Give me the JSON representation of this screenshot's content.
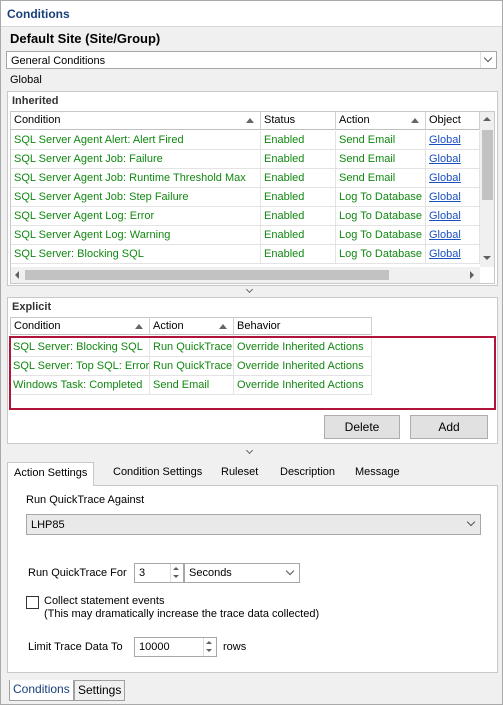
{
  "window": {
    "title": "Conditions"
  },
  "site_title": "Default Site (Site/Group)",
  "condition_type_combo": {
    "value": "General Conditions"
  },
  "global_label": "Global",
  "inherited": {
    "title": "Inherited",
    "columns": [
      "Condition",
      "Status",
      "Action",
      "Object"
    ],
    "rows": [
      [
        "SQL Server Agent Alert: Alert Fired",
        "Enabled",
        "Send Email",
        "Global"
      ],
      [
        "SQL Server Agent Job: Failure",
        "Enabled",
        "Send Email",
        "Global"
      ],
      [
        "SQL Server Agent Job: Runtime Threshold Max",
        "Enabled",
        "Send Email",
        "Global"
      ],
      [
        "SQL Server Agent Job: Step Failure",
        "Enabled",
        "Log To Database",
        "Global"
      ],
      [
        "SQL Server Agent Log: Error",
        "Enabled",
        "Log To Database",
        "Global"
      ],
      [
        "SQL Server Agent Log: Warning",
        "Enabled",
        "Log To Database",
        "Global"
      ],
      [
        "SQL Server: Blocking SQL",
        "Enabled",
        "Log To Database",
        "Global"
      ]
    ]
  },
  "explicit": {
    "title": "Explicit",
    "columns": [
      "Condition",
      "Action",
      "Behavior"
    ],
    "rows": [
      [
        "SQL Server: Blocking SQL",
        "Run QuickTrace",
        "Override Inherited Actions"
      ],
      [
        "SQL Server: Top SQL: Error",
        "Run QuickTrace",
        "Override Inherited Actions"
      ],
      [
        "Windows Task: Completed",
        "Send Email",
        "Override Inherited Actions"
      ]
    ],
    "delete_label": "Delete",
    "add_label": "Add"
  },
  "tabs": [
    "Action Settings",
    "Condition Settings",
    "Ruleset",
    "Description",
    "Message"
  ],
  "action_settings": {
    "run_against_label": "Run QuickTrace Against",
    "run_against_value": "LHP85",
    "run_for_label": "Run QuickTrace For",
    "run_for_value": "3",
    "run_for_unit": "Seconds",
    "collect_label": "Collect statement events",
    "collect_note": "(This may dramatically increase the trace data collected)",
    "limit_label": "Limit Trace Data To",
    "limit_value": "10000",
    "limit_unit": "rows"
  },
  "bottom_tabs": [
    "Conditions",
    "Settings"
  ],
  "colors": {
    "accent": "#1a3f7a",
    "condition_text": "#118811",
    "link": "#1a4fbf",
    "highlight": "#b0143a"
  }
}
